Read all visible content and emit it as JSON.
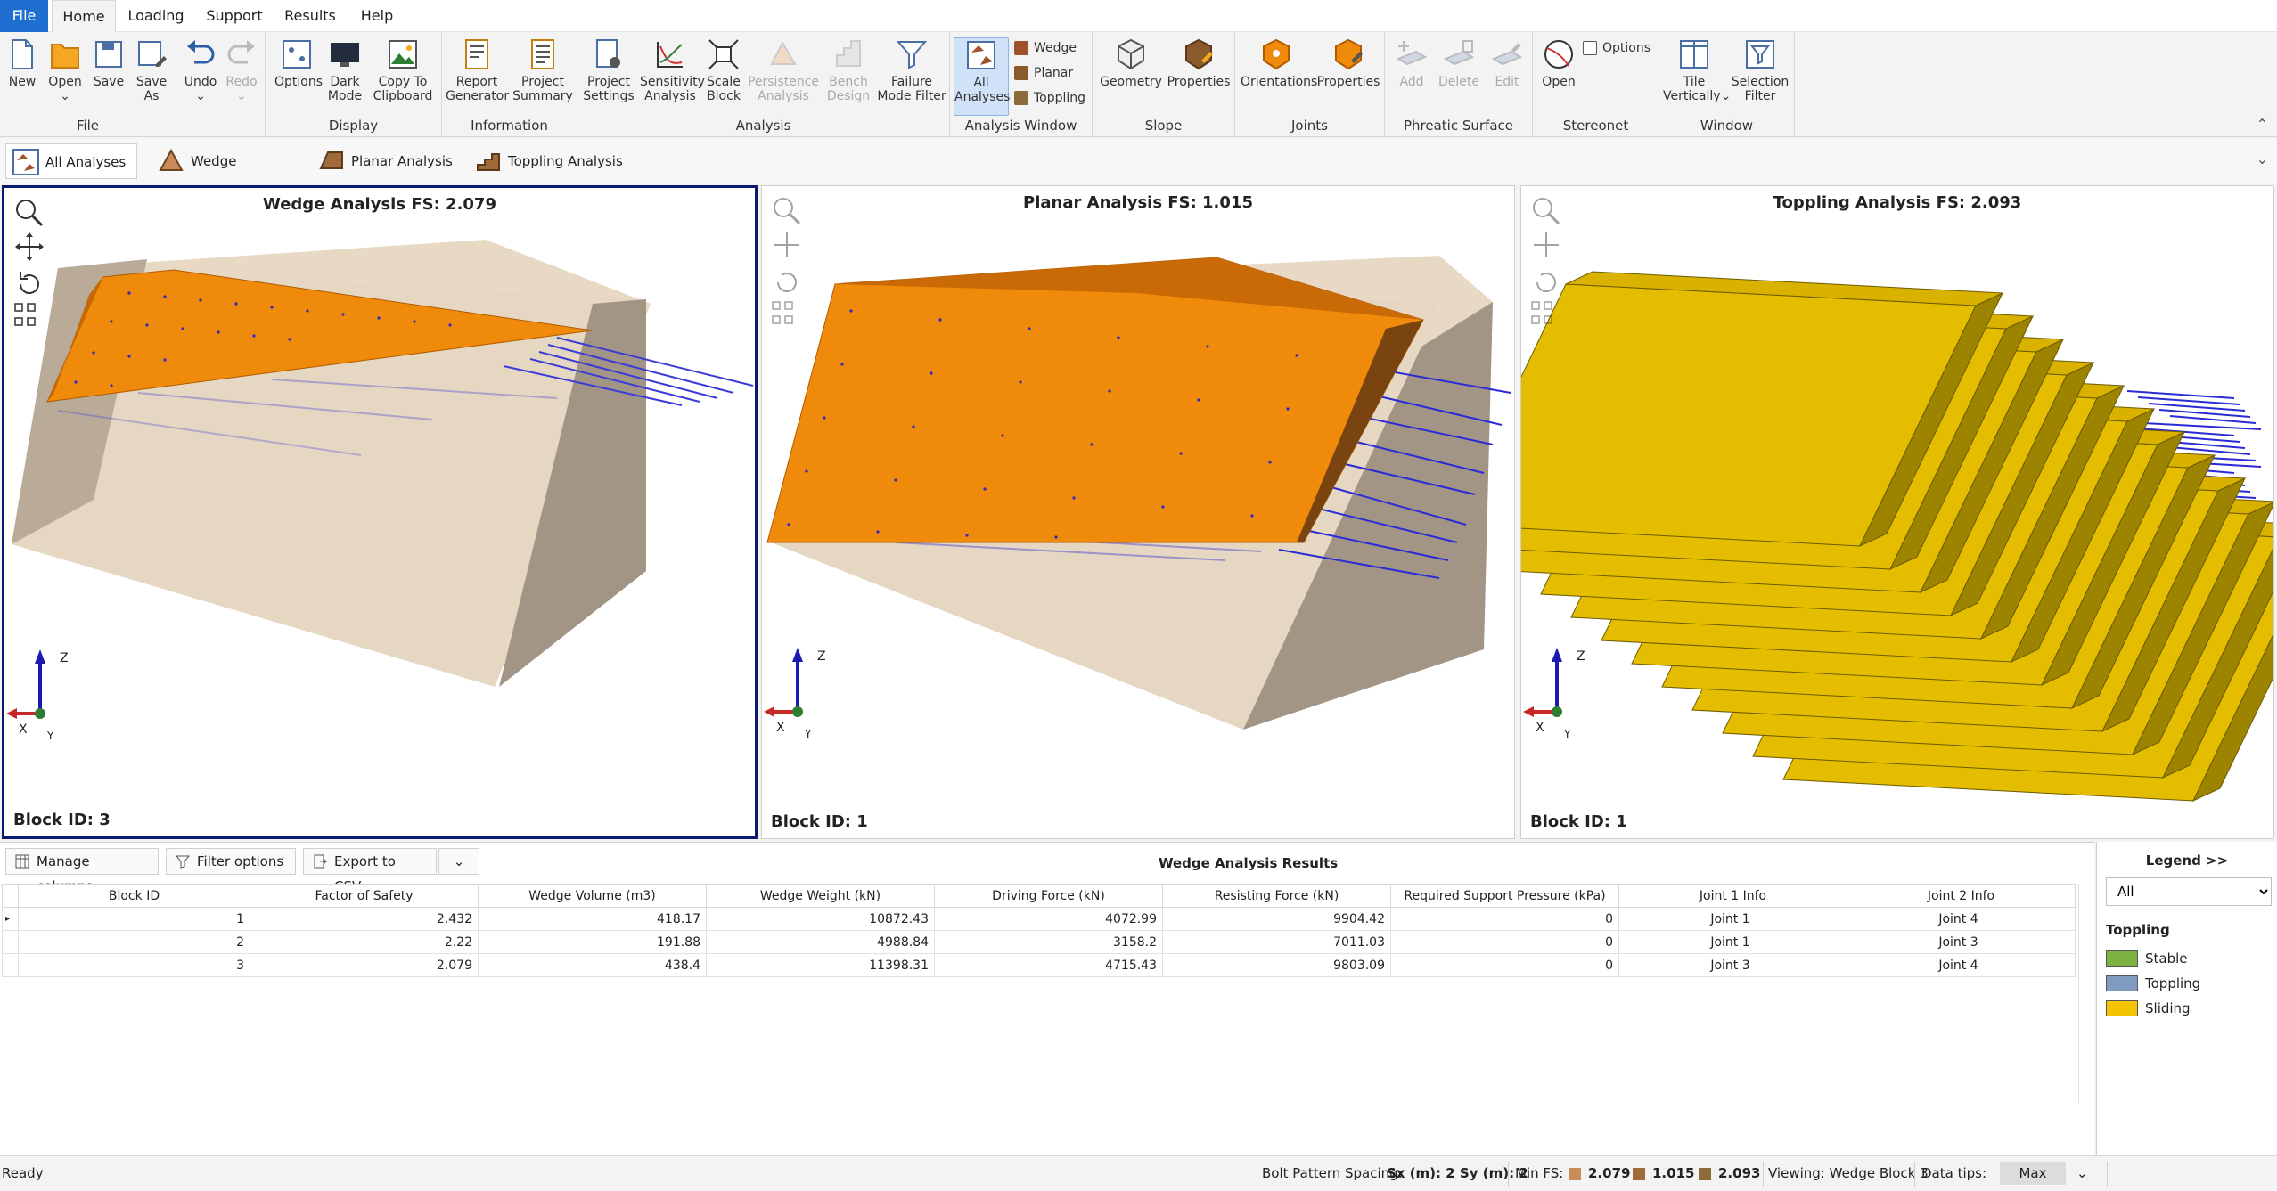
{
  "menu": {
    "items": [
      "File",
      "Home",
      "Loading",
      "Support",
      "Results",
      "Help"
    ]
  },
  "ribbon": {
    "groups": {
      "file": "File",
      "display": "Display",
      "information": "Information",
      "analysis": "Analysis",
      "analysis_window": "Analysis Window",
      "slope": "Slope",
      "joints": "Joints",
      "phreatic": "Phreatic Surface",
      "stereonet": "Stereonet",
      "window": "Window"
    },
    "buttons": {
      "new": "New",
      "open": "Open",
      "save": "Save",
      "save_as_1": "Save",
      "save_as_2": "As",
      "undo": "Undo",
      "redo": "Redo",
      "options": "Options",
      "dark_1": "Dark",
      "dark_2": "Mode",
      "copy_1": "Copy To",
      "copy_2": "Clipboard",
      "report_1": "Report",
      "report_2": "Generator",
      "summary_1": "Project",
      "summary_2": "Summary",
      "psettings_1": "Project",
      "psettings_2": "Settings",
      "sens_1": "Sensitivity",
      "sens_2": "Analysis",
      "scale_1": "Scale",
      "scale_2": "Block",
      "persist_1": "Persistence",
      "persist_2": "Analysis",
      "bench_1": "Bench",
      "bench_2": "Design",
      "failure_1": "Failure",
      "failure_2": "Mode Filter",
      "all_1": "All",
      "all_2": "Analyses",
      "wedge": "Wedge",
      "planar": "Planar",
      "toppling": "Toppling",
      "geometry": "Geometry",
      "slope_props": "Properties",
      "orientations": "Orientations",
      "joint_props": "Properties",
      "add": "Add",
      "delete": "Delete",
      "edit": "Edit",
      "stereo_open": "Open",
      "stereo_options": "Options",
      "tile_1": "Tile",
      "tile_2": "Vertically",
      "sel_1": "Selection",
      "sel_2": "Filter"
    }
  },
  "view_tabs": [
    "All Analyses",
    "Wedge Analysis",
    "Planar Analysis",
    "Toppling Analysis"
  ],
  "viewports": [
    {
      "title": "Wedge Analysis FS: 2.079",
      "block": "Block ID: 3"
    },
    {
      "title": "Planar Analysis FS: 1.015",
      "block": "Block ID: 1"
    },
    {
      "title": "Toppling Analysis FS: 2.093",
      "block": "Block ID: 1"
    }
  ],
  "axes": {
    "z": "Z",
    "x": "X",
    "y": "Y"
  },
  "results": {
    "buttons": {
      "manage": "Manage columns",
      "filter": "Filter options",
      "export": "Export to CSV..."
    },
    "title": "Wedge Analysis Results",
    "columns": [
      "Block ID",
      "Factor of Safety",
      "Wedge Volume (m3)",
      "Wedge Weight (kN)",
      "Driving Force (kN)",
      "Resisting Force (kN)",
      "Required Support Pressure (kPa)",
      "Joint 1 Info",
      "Joint 2 Info"
    ],
    "rows": [
      [
        "1",
        "2.432",
        "418.17",
        "10872.43",
        "4072.99",
        "9904.42",
        "0",
        "Joint 1",
        "Joint 4"
      ],
      [
        "2",
        "2.22",
        "191.88",
        "4988.84",
        "3158.2",
        "7011.03",
        "0",
        "Joint 1",
        "Joint 3"
      ],
      [
        "3",
        "2.079",
        "438.4",
        "11398.31",
        "4715.43",
        "9803.09",
        "0",
        "Joint 3",
        "Joint 4"
      ]
    ]
  },
  "legend": {
    "header": "Legend >>",
    "filter": "All",
    "title": "Toppling",
    "items": [
      {
        "label": "Stable",
        "color": "#7cb342"
      },
      {
        "label": "Toppling",
        "color": "#7f9cc0"
      },
      {
        "label": "Sliding",
        "color": "#f2c500"
      }
    ]
  },
  "status": {
    "ready": "Ready",
    "bolt_label": "Bolt Pattern Spacing:",
    "bolt_value": "Sx (m): 2 Sy (m): 2",
    "minfs_label": "Min FS:",
    "fs_wedge": "2.079",
    "fs_planar": "1.015",
    "fs_toppling": "2.093",
    "viewing": "Viewing: Wedge Block 3",
    "datatips_label": "Data tips:",
    "datatips_value": "Max"
  },
  "colors": {
    "accent": "#1e6fd0",
    "rock": "#e8d9c4",
    "wedge_face": "#f08a0a",
    "toppling": "#d9b200",
    "bolt": "#2222cc"
  }
}
